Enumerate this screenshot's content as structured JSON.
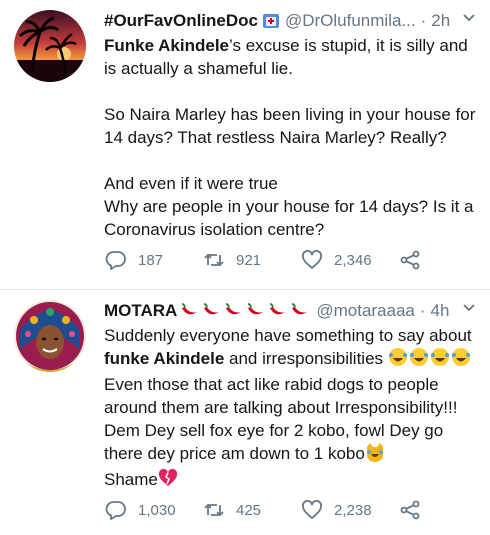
{
  "tweets": [
    {
      "display_name": "#OurFavOnlineDoc",
      "handle": "@DrOlufunmila...",
      "dot": "·",
      "time": "2h",
      "body": {
        "p1_bold": "Funke Akindele",
        "p1_rest": "’s excuse is stupid, it is silly and is actually a shameful lie.",
        "p2": "So Naira Marley has been living in your house for 14 days? That restless Naira Marley? Really?",
        "p3_line1": "And even if it were true",
        "p3_line2": "Why are people in your house for 14 days? Is it a Coronavirus isolation centre?"
      },
      "replies": "187",
      "retweets": "921",
      "likes": "2,346"
    },
    {
      "display_name": "MOTARA",
      "handle": "@motaraaaa",
      "dot": "·",
      "time": "4h",
      "body": {
        "line1": "Suddenly everyone have something to say about",
        "line2_bold": "funke Akindele",
        "line2_rest": " and irresponsibilities ",
        "line3": "Even those that act like rabid dogs to people around them are talking about Irresponsibility!!! Dem Dey sell fox eye for 2 kobo, fowl Dey go there dey price am down to 1 kobo",
        "line4": "Shame"
      },
      "replies": "1,030",
      "retweets": "425",
      "likes": "2,238"
    }
  ],
  "icons": {
    "reply": "reply-icon",
    "retweet": "retweet-icon",
    "like": "heart-icon",
    "share": "share-icon",
    "more": "chevron-down-icon"
  },
  "colors": {
    "text": "#14171a",
    "muted": "#657786",
    "divider": "#e1e8ed",
    "pepper": "#d0021b"
  }
}
